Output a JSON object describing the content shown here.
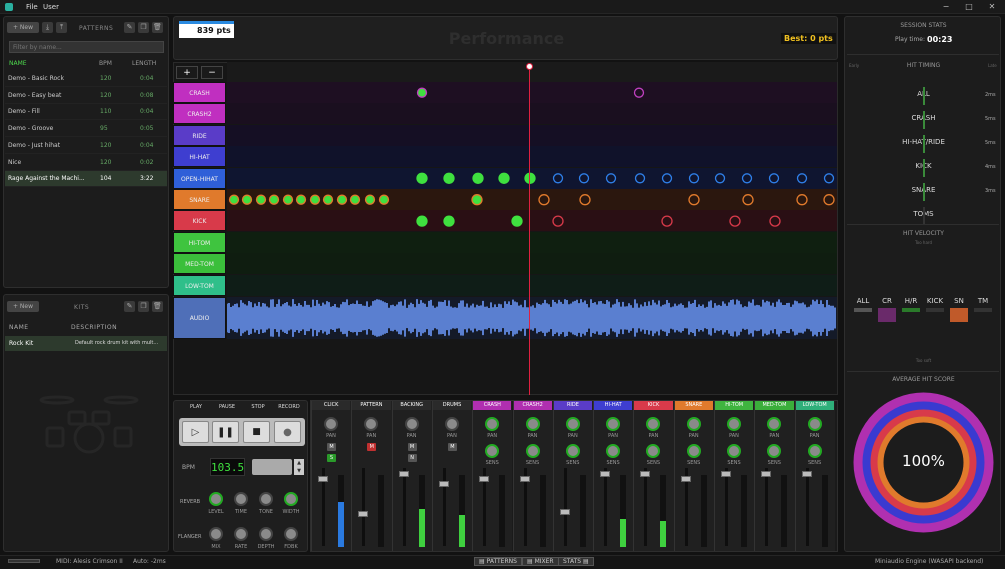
{
  "menu": {
    "file": "File",
    "user": "User"
  },
  "patterns": {
    "new_label": "+ New",
    "header": "PATTERNS",
    "filter_placeholder": "Filter by name...",
    "cols": {
      "name": "NAME",
      "bpm": "BPM",
      "length": "LENGTH"
    },
    "rows": [
      {
        "name": "Demo - Basic Rock",
        "bpm": "120",
        "length": "0:04"
      },
      {
        "name": "Demo - Easy beat",
        "bpm": "120",
        "length": "0:08"
      },
      {
        "name": "Demo - Fill",
        "bpm": "110",
        "length": "0:04"
      },
      {
        "name": "Demo - Groove",
        "bpm": "95",
        "length": "0:05"
      },
      {
        "name": "Demo - Just hihat",
        "bpm": "120",
        "length": "0:04"
      },
      {
        "name": "Nice",
        "bpm": "120",
        "length": "0:02"
      },
      {
        "name": "Rage Against the Machi...",
        "bpm": "104",
        "length": "3:22"
      }
    ]
  },
  "kits": {
    "new_label": "+ New",
    "header": "KITS",
    "cols": {
      "name": "NAME",
      "description": "DESCRIPTION"
    },
    "rows": [
      {
        "name": "Rock Kit",
        "description": "Default rock drum kit with mult..."
      }
    ]
  },
  "performance": {
    "score": "839 pts",
    "title": "Performance",
    "best": "Best: 0 pts",
    "zoom_in": "+",
    "zoom_out": "−"
  },
  "lanes": [
    {
      "label": "CRASH",
      "color": "#c02fc0",
      "band": "#1e0f22"
    },
    {
      "label": "CRASH2",
      "color": "#c02fc0",
      "band": "#1a0f1f"
    },
    {
      "label": "RIDE",
      "color": "#5a3cc8",
      "band": "#150f24"
    },
    {
      "label": "HI-HAT",
      "color": "#3e3ed0",
      "band": "#10122a"
    },
    {
      "label": "OPEN-HIHAT",
      "color": "#2f5fd8",
      "band": "#0f1530"
    },
    {
      "label": "SNARE",
      "color": "#e07a2c",
      "band": "#2b170e"
    },
    {
      "label": "KICK",
      "color": "#d83a4a",
      "band": "#2a0f14"
    },
    {
      "label": "HI-TOM",
      "color": "#3fc43f",
      "band": "#0f1f10"
    },
    {
      "label": "MED-TOM",
      "color": "#3bbf3b",
      "band": "#0f1d10"
    },
    {
      "label": "LOW-TOM",
      "color": "#2fbf8a",
      "band": "#0f1d17"
    },
    {
      "label": "AUDIO",
      "color": "#4f6fb8",
      "band": "#141a28"
    }
  ],
  "transport": {
    "play": "PLAY",
    "pause": "PAUSE",
    "stop": "STOP",
    "record": "RECORD",
    "bpm_label": "BPM",
    "bpm_value": "103.5",
    "reverb_label": "REVERB",
    "flanger_label": "FLANGER",
    "reverb_knobs": [
      "LEVEL",
      "TIME",
      "TONE",
      "WIDTH"
    ],
    "flanger_knobs": [
      "MIX",
      "RATE",
      "DEPTH",
      "FDBK"
    ]
  },
  "mixer": {
    "pan": "PAN",
    "sens": "SENS",
    "m": "M",
    "s": "S",
    "n": "N",
    "channels": [
      {
        "name": "CLICK",
        "color": "#2a2a2a"
      },
      {
        "name": "PATTERN",
        "color": "#2a2a2a"
      },
      {
        "name": "BACKING",
        "color": "#2a2a2a"
      },
      {
        "name": "DRUMS",
        "color": "#2a2a2a"
      },
      {
        "name": "CRASH",
        "color": "#b02fb0"
      },
      {
        "name": "CRASH2",
        "color": "#b02fb0"
      },
      {
        "name": "RIDE",
        "color": "#5a3cc8"
      },
      {
        "name": "HI-HAT",
        "color": "#3e3ed0"
      },
      {
        "name": "KICK",
        "color": "#d83a4a"
      },
      {
        "name": "SNARE",
        "color": "#e07a2c"
      },
      {
        "name": "HI-TOM",
        "color": "#3fb43f"
      },
      {
        "name": "MED-TOM",
        "color": "#3bae3b"
      },
      {
        "name": "LOW-TOM",
        "color": "#2faf7a"
      }
    ]
  },
  "session": {
    "title": "SESSION STATS",
    "playtime_label": "Play time:",
    "playtime": "00:23",
    "hit_timing": "HIT TIMING",
    "early": "Early",
    "late": "Late",
    "timing": [
      {
        "label": "ALL",
        "value": "2ms"
      },
      {
        "label": "CRASH",
        "value": "5ms"
      },
      {
        "label": "HI-HAT/RIDE",
        "value": "5ms"
      },
      {
        "label": "KICK",
        "value": "4ms"
      },
      {
        "label": "SNARE",
        "value": "3ms"
      },
      {
        "label": "TOMS",
        "value": ""
      }
    ],
    "hit_velocity": "HIT VELOCITY",
    "too_hard": "Too hard",
    "too_soft": "Too soft",
    "velocity": [
      {
        "label": "ALL",
        "color": "#555"
      },
      {
        "label": "CR",
        "color": "#6a2a6a"
      },
      {
        "label": "H/R",
        "color": "#2a7a2a"
      },
      {
        "label": "KICK",
        "color": "#333"
      },
      {
        "label": "SN",
        "color": "#c05a2a"
      },
      {
        "label": "TM",
        "color": "#333"
      }
    ],
    "avg_score": "AVERAGE HIT SCORE",
    "avg_value": "100%"
  },
  "footer": {
    "midi": "MIDI: Alesis Crimson II",
    "auto": "Auto: -2ms",
    "tabs": [
      "PATTERNS",
      "MIXER",
      "STATS"
    ],
    "engine": "Miniaudio Engine (WASAPI backend)"
  }
}
